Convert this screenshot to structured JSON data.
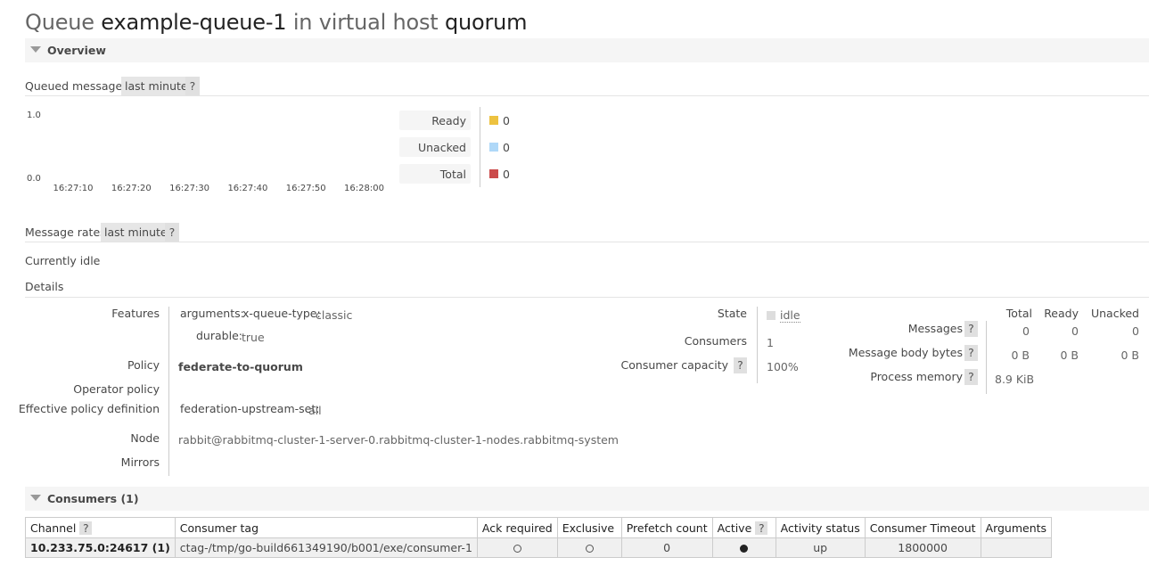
{
  "title": {
    "prefix": "Queue",
    "queue": "example-queue-1",
    "middle": "in virtual host",
    "vhost": "quorum"
  },
  "overview": {
    "label": "Overview"
  },
  "queued_messages": {
    "label": "Queued messages",
    "range": "last minute",
    "help": "?"
  },
  "chart_data": {
    "type": "line",
    "ylim": [
      0.0,
      1.0
    ],
    "yticks": [
      "1.0",
      "0.0"
    ],
    "xticks": [
      "16:27:10",
      "16:27:20",
      "16:27:30",
      "16:27:40",
      "16:27:50",
      "16:28:00"
    ],
    "series": [
      {
        "name": "Ready",
        "values": [
          0,
          0,
          0,
          0,
          0,
          0
        ],
        "color": "#edc240"
      },
      {
        "name": "Unacked",
        "values": [
          0,
          0,
          0,
          0,
          0,
          0
        ],
        "color": "#afd8f8"
      },
      {
        "name": "Total",
        "values": [
          0,
          0,
          0,
          0,
          0,
          0
        ],
        "color": "#cb4b4b"
      }
    ]
  },
  "legend": [
    {
      "label": "Ready",
      "value": "0",
      "color": "#edc240"
    },
    {
      "label": "Unacked",
      "value": "0",
      "color": "#afd8f8"
    },
    {
      "label": "Total",
      "value": "0",
      "color": "#cb4b4b"
    }
  ],
  "message_rates": {
    "label": "Message rates",
    "range": "last minute",
    "help": "?",
    "status": "Currently idle"
  },
  "details": {
    "label": "Details",
    "features_label": "Features",
    "arguments_key": "arguments:",
    "queue_type_key": "x-queue-type:",
    "queue_type_value": "classic",
    "durable_key": "durable:",
    "durable_value": "true",
    "policy_label": "Policy",
    "policy_value": "federate-to-quorum",
    "operator_policy_label": "Operator policy",
    "effective_policy_label": "Effective policy definition",
    "effective_policy_key": "federation-upstream-set:",
    "effective_policy_value": "all",
    "node_label": "Node",
    "node_value": "rabbit@rabbitmq-cluster-1-server-0.rabbitmq-cluster-1-nodes.rabbitmq-system",
    "mirrors_label": "Mirrors",
    "state_label": "State",
    "state_value": "idle",
    "consumers_label": "Consumers",
    "consumers_value": "1",
    "capacity_label": "Consumer capacity",
    "capacity_help": "?",
    "capacity_value": "100%"
  },
  "message_stats": {
    "headers": [
      "Total",
      "Ready",
      "Unacked"
    ],
    "rows": [
      {
        "label": "Messages",
        "help": "?",
        "values": [
          "0",
          "0",
          "0"
        ]
      },
      {
        "label": "Message body bytes",
        "help": "?",
        "values": [
          "0 B",
          "0 B",
          "0 B"
        ]
      },
      {
        "label": "Process memory",
        "help": "?",
        "values": [
          "8.9 KiB"
        ]
      }
    ]
  },
  "consumers": {
    "label": "Consumers (1)",
    "columns": [
      "Channel",
      "Consumer tag",
      "Ack required",
      "Exclusive",
      "Prefetch count",
      "Active",
      "Activity status",
      "Consumer Timeout",
      "Arguments"
    ],
    "help": "?",
    "rows": [
      {
        "channel": "10.233.75.0:24617 (1)",
        "consumer_tag": "ctag-/tmp/go-build661349190/b001/exe/consumer-1",
        "ack_required": "open",
        "exclusive": "open",
        "prefetch_count": "0",
        "active": "filled",
        "activity_status": "up",
        "consumer_timeout": "1800000",
        "arguments": ""
      }
    ]
  }
}
